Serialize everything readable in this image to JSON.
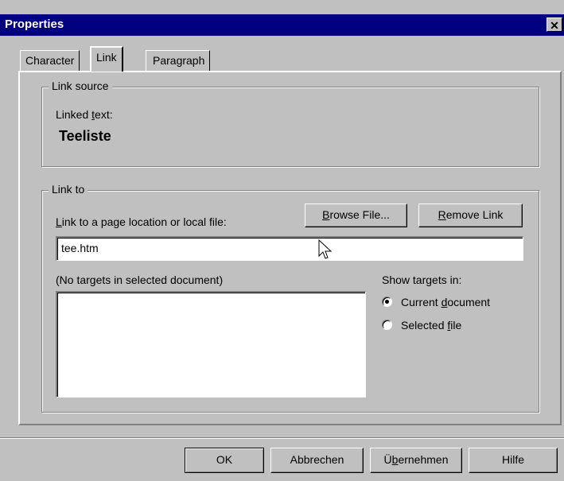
{
  "window": {
    "title": "Properties",
    "close_glyph": "✕"
  },
  "tabs": [
    {
      "label": "Character"
    },
    {
      "label": "Link"
    },
    {
      "label": "Paragraph"
    }
  ],
  "link_source": {
    "legend": "Link source",
    "linked_text_label_pre": "Linked ",
    "linked_text_label_u": "t",
    "linked_text_label_post": "ext:",
    "linked_text_value": "Teeliste"
  },
  "link_to": {
    "legend": "Link to",
    "location_label_u": "L",
    "location_label_post": "ink to a page location or local file:",
    "browse_button_u": "B",
    "browse_button_post": "rowse File...",
    "remove_button_u": "R",
    "remove_button_post": "emove Link",
    "location_value": "tee.htm",
    "targets_message": "(No targets in selected document)",
    "show_targets_label": "Show targets in:",
    "radio_current_pre": "Current ",
    "radio_current_u": "d",
    "radio_current_post": "ocument",
    "radio_selected_pre": "Selected ",
    "radio_selected_u": "f",
    "radio_selected_post": "ile",
    "selected_radio": "current"
  },
  "buttons": {
    "ok": "OK",
    "cancel": "Abbrechen",
    "apply_pre": "Ü",
    "apply_u": "b",
    "apply_post": "ernehmen",
    "help": "Hilfe"
  }
}
